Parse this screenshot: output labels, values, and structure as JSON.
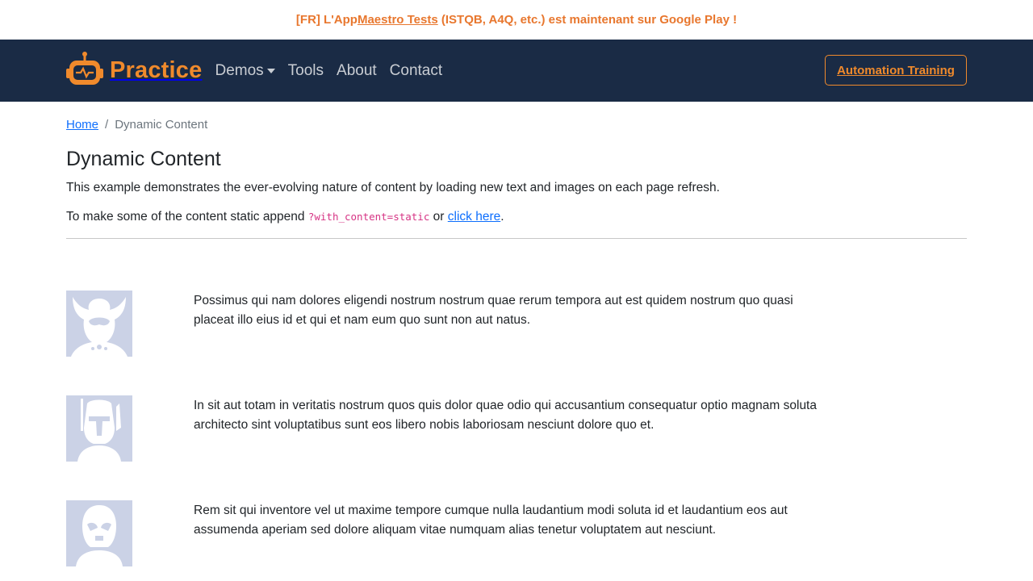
{
  "announcement": {
    "prefix": "[FR] L'App ",
    "link": "Maestro Tests",
    "suffix": " (ISTQB, A4Q, etc.) est maintenant sur Google Play !"
  },
  "navbar": {
    "brand": "Practice",
    "links": [
      "Demos",
      "Tools",
      "About",
      "Contact"
    ],
    "cta": "Automation Training",
    "colors": {
      "background": "#1a2b45",
      "accent": "#f08a2c"
    }
  },
  "breadcrumb": {
    "home": "Home",
    "separator": "/",
    "current": "Dynamic Content"
  },
  "page": {
    "title": "Dynamic Content",
    "description": "This example demonstrates the ever-evolving nature of content by loading new text and images on each page refresh.",
    "static_prefix": "To make some of the content static append ",
    "static_code": "?with_content=static",
    "static_or": " or ",
    "static_link": "click here",
    "static_end": "."
  },
  "rows": [
    {
      "icon": "jester-avatar-icon",
      "text": "Possimus qui nam dolores eligendi nostrum nostrum quae rerum tempora aut est quidem nostrum quo quasi placeat illo eius id et qui et nam eum quo sunt non aut natus."
    },
    {
      "icon": "bounty-hunter-avatar-icon",
      "text": "In sit aut totam in veritatis nostrum quos quis dolor quae odio qui accusantium consequatur optio magnam soluta architecto sint voluptatibus sunt eos libero nobis laboriosam nesciunt dolore quo et."
    },
    {
      "icon": "trooper-avatar-icon",
      "text": "Rem sit qui inventore vel ut maxime tempore cumque nulla laudantium modi soluta id et laudantium eos aut assumenda aperiam sed dolore aliquam vitae numquam alias tenetur voluptatem aut nesciunt."
    }
  ]
}
